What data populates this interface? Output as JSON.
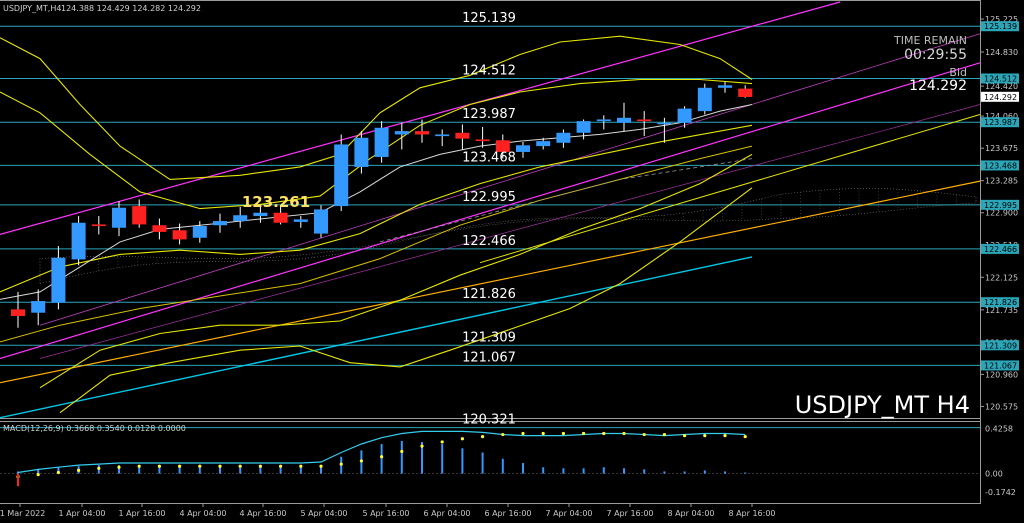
{
  "header": {
    "symbol_text": "USDJPY_MT,H4",
    "ohlc_text": "124.388 124.429 124.282 124.292"
  },
  "watermark": "USDJPY_MT H4",
  "info": {
    "time_remain_label": "TIME REMAIN",
    "time_remain_value": "00:29:55",
    "bid_label": "Bid",
    "bid_value": "124.292"
  },
  "colors": {
    "background": "#000000",
    "bull": "#3399ff",
    "bear": "#ff2020",
    "level_line": "#2aa6b8",
    "channel": "#ff33ff",
    "envelope": "#e6e600",
    "trend_orange": "#ffb000",
    "trend_cyan": "#00c8e6",
    "ma_white": "#d9d9d9",
    "macd_signal": "#ffff33",
    "macd_line": "#33ccee",
    "macd_hist": "#3399ff",
    "axis_text": "#c8c8c8"
  },
  "chart_data": {
    "type": "candlestick",
    "symbol": "USDJPY_MT",
    "timeframe": "H4",
    "ylim": [
      120.46,
      125.43
    ],
    "y_ticks": [
      "125.225",
      "124.830",
      "124.420",
      "124.060",
      "123.675",
      "123.285",
      "122.900",
      "122.510",
      "122.125",
      "121.735",
      "121.340",
      "120.960",
      "120.575"
    ],
    "x_tick_labels": [
      "31 Mar 2022",
      "1 Apr 04:00",
      "1 Apr 16:00",
      "4 Apr 04:00",
      "4 Apr 16:00",
      "5 Apr 04:00",
      "5 Apr 16:00",
      "6 Apr 04:00",
      "6 Apr 16:00",
      "7 Apr 04:00",
      "7 Apr 16:00",
      "8 Apr 04:00",
      "8 Apr 16:00"
    ],
    "candles": [
      {
        "o": 121.74,
        "h": 121.95,
        "l": 121.52,
        "c": 121.66
      },
      {
        "o": 121.7,
        "h": 121.98,
        "l": 121.55,
        "c": 121.84
      },
      {
        "o": 121.82,
        "h": 122.5,
        "l": 121.74,
        "c": 122.36
      },
      {
        "o": 122.34,
        "h": 122.86,
        "l": 122.27,
        "c": 122.78
      },
      {
        "o": 122.76,
        "h": 122.86,
        "l": 122.64,
        "c": 122.74
      },
      {
        "o": 122.72,
        "h": 123.04,
        "l": 122.62,
        "c": 122.96
      },
      {
        "o": 122.98,
        "h": 123.06,
        "l": 122.72,
        "c": 122.76
      },
      {
        "o": 122.75,
        "h": 122.83,
        "l": 122.58,
        "c": 122.67
      },
      {
        "o": 122.69,
        "h": 122.77,
        "l": 122.52,
        "c": 122.58
      },
      {
        "o": 122.6,
        "h": 122.8,
        "l": 122.54,
        "c": 122.74
      },
      {
        "o": 122.75,
        "h": 122.89,
        "l": 122.66,
        "c": 122.8
      },
      {
        "o": 122.8,
        "h": 122.97,
        "l": 122.72,
        "c": 122.87
      },
      {
        "o": 122.86,
        "h": 122.98,
        "l": 122.78,
        "c": 122.9
      },
      {
        "o": 122.9,
        "h": 122.99,
        "l": 122.76,
        "c": 122.78
      },
      {
        "o": 122.79,
        "h": 122.86,
        "l": 122.72,
        "c": 122.82
      },
      {
        "o": 122.65,
        "h": 122.99,
        "l": 122.6,
        "c": 122.94
      },
      {
        "o": 122.98,
        "h": 123.84,
        "l": 122.92,
        "c": 123.72
      },
      {
        "o": 123.45,
        "h": 123.88,
        "l": 123.37,
        "c": 123.8
      },
      {
        "o": 123.57,
        "h": 124.0,
        "l": 123.5,
        "c": 123.92
      },
      {
        "o": 123.84,
        "h": 123.98,
        "l": 123.66,
        "c": 123.88
      },
      {
        "o": 123.88,
        "h": 124.02,
        "l": 123.74,
        "c": 123.84
      },
      {
        "o": 123.82,
        "h": 123.9,
        "l": 123.7,
        "c": 123.84
      },
      {
        "o": 123.86,
        "h": 123.96,
        "l": 123.66,
        "c": 123.79
      },
      {
        "o": 123.78,
        "h": 123.93,
        "l": 123.68,
        "c": 123.76
      },
      {
        "o": 123.77,
        "h": 123.84,
        "l": 123.55,
        "c": 123.63
      },
      {
        "o": 123.63,
        "h": 123.75,
        "l": 123.56,
        "c": 123.71
      },
      {
        "o": 123.7,
        "h": 123.8,
        "l": 123.66,
        "c": 123.76
      },
      {
        "o": 123.74,
        "h": 123.9,
        "l": 123.68,
        "c": 123.86
      },
      {
        "o": 123.86,
        "h": 124.02,
        "l": 123.78,
        "c": 124.0
      },
      {
        "o": 124.0,
        "h": 124.07,
        "l": 123.9,
        "c": 124.02
      },
      {
        "o": 123.98,
        "h": 124.22,
        "l": 123.88,
        "c": 124.04
      },
      {
        "o": 124.02,
        "h": 124.12,
        "l": 123.82,
        "c": 124.0
      },
      {
        "o": 123.98,
        "h": 124.04,
        "l": 123.74,
        "c": 123.98
      },
      {
        "o": 123.98,
        "h": 124.18,
        "l": 123.92,
        "c": 124.15
      },
      {
        "o": 124.12,
        "h": 124.45,
        "l": 124.08,
        "c": 124.4
      },
      {
        "o": 124.4,
        "h": 124.47,
        "l": 124.34,
        "c": 124.43
      },
      {
        "o": 124.39,
        "h": 124.43,
        "l": 124.28,
        "c": 124.29
      }
    ],
    "levels": [
      "125.139",
      "124.512",
      "123.987",
      "123.468",
      "122.995",
      "122.466",
      "121.826",
      "121.309",
      "121.067",
      "120.321"
    ],
    "highlighted_price": "123.261",
    "price_tags": [
      {
        "text": "125.139",
        "kind": "level"
      },
      {
        "text": "124.512",
        "kind": "level"
      },
      {
        "text": "124.292",
        "kind": "bid"
      },
      {
        "text": "123.987",
        "kind": "level"
      },
      {
        "text": "123.468",
        "kind": "level"
      },
      {
        "text": "122.995",
        "kind": "level"
      },
      {
        "text": "122.466",
        "kind": "level"
      },
      {
        "text": "121.826",
        "kind": "level"
      },
      {
        "text": "121.309",
        "kind": "level"
      },
      {
        "text": "121.067",
        "kind": "level"
      }
    ],
    "macd": {
      "label": "MACD(12,26,9) 0.3668 0.3540 0.0128 0.0000",
      "ylim": [
        -0.26,
        0.47
      ],
      "y_ticks": [
        "0.4258",
        "0.00",
        "-0.1742"
      ],
      "histogram": [
        0.02,
        0.04,
        0.06,
        0.07,
        0.08,
        0.08,
        0.08,
        0.08,
        0.07,
        0.07,
        0.07,
        0.07,
        0.07,
        0.07,
        0.07,
        0.07,
        0.16,
        0.22,
        0.28,
        0.31,
        0.3,
        0.28,
        0.24,
        0.2,
        0.14,
        0.1,
        0.06,
        0.05,
        0.05,
        0.06,
        0.05,
        0.04,
        0.02,
        0.02,
        0.03,
        0.02,
        0.01
      ],
      "signal": [
        -0.03,
        -0.01,
        0.01,
        0.03,
        0.05,
        0.06,
        0.07,
        0.07,
        0.07,
        0.07,
        0.07,
        0.07,
        0.07,
        0.07,
        0.07,
        0.07,
        0.09,
        0.12,
        0.16,
        0.21,
        0.26,
        0.3,
        0.33,
        0.35,
        0.37,
        0.38,
        0.38,
        0.38,
        0.38,
        0.38,
        0.38,
        0.37,
        0.37,
        0.36,
        0.36,
        0.36,
        0.35
      ],
      "macd_line": [
        0.01,
        0.04,
        0.06,
        0.08,
        0.09,
        0.1,
        0.1,
        0.1,
        0.1,
        0.1,
        0.1,
        0.1,
        0.1,
        0.1,
        0.1,
        0.11,
        0.2,
        0.28,
        0.34,
        0.38,
        0.4,
        0.4,
        0.4,
        0.39,
        0.37,
        0.36,
        0.36,
        0.36,
        0.37,
        0.38,
        0.38,
        0.37,
        0.36,
        0.37,
        0.38,
        0.38,
        0.37
      ]
    }
  }
}
